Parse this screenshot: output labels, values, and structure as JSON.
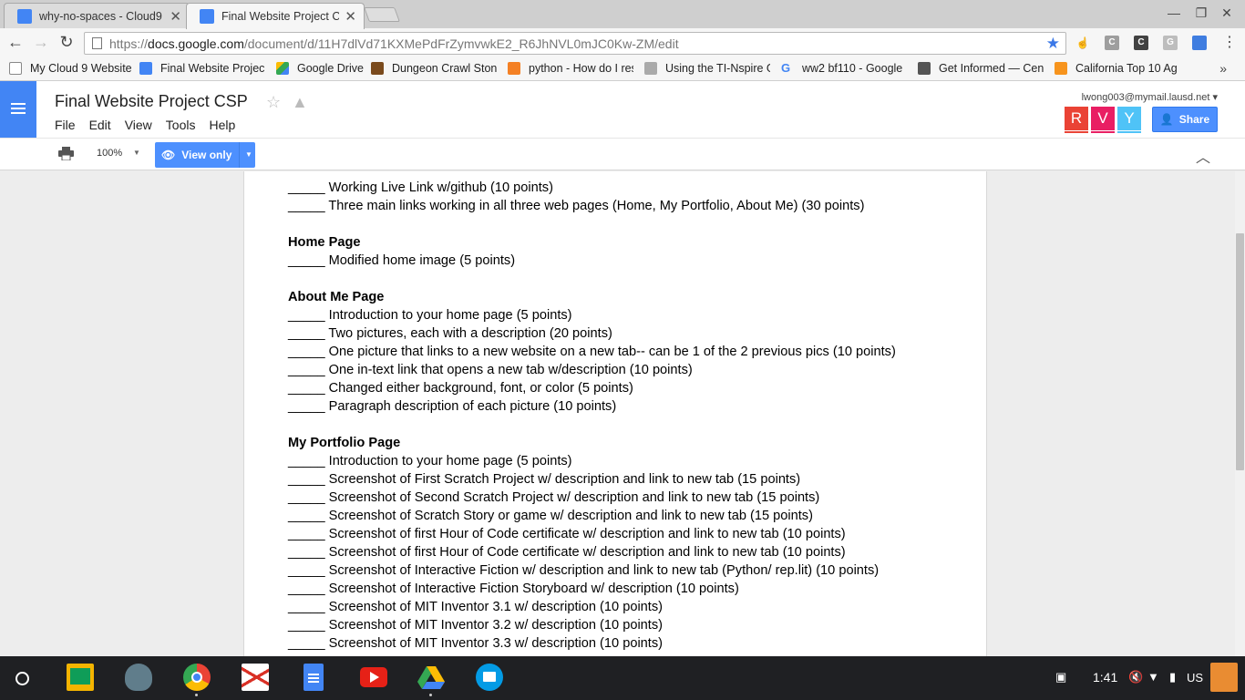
{
  "browser": {
    "tabs": [
      {
        "title": "why-no-spaces - Cloud9",
        "active": false,
        "favicon_color": "#4285f4"
      },
      {
        "title": "Final Website Project CS",
        "active": true,
        "favicon_color": "#4285f4"
      }
    ],
    "url": {
      "scheme": "https://",
      "host": "docs.google.com",
      "path": "/document/d/11H7dlVd71KXMePdFrZymvwkE2_R6JhNVL0mJC0Kw-ZM/edit"
    },
    "extensions": [
      "C",
      "C",
      "G"
    ],
    "bookmarks": [
      {
        "label": "My Cloud 9 Website",
        "icon": "page-icon",
        "color": "#888888"
      },
      {
        "label": "Final Website Project",
        "icon": "docs-icon",
        "color": "#4285f4"
      },
      {
        "label": "Google Drive",
        "icon": "drive-icon",
        "color": "#fbbc05"
      },
      {
        "label": "Dungeon Crawl Ston",
        "icon": "dungeon-icon",
        "color": "#7a4a1c"
      },
      {
        "label": "python - How do I res",
        "icon": "stackoverflow-icon",
        "color": "#f48024"
      },
      {
        "label": "Using the TI-Nspire G",
        "icon": "ti-icon",
        "color": "#aaaaaa"
      },
      {
        "label": "ww2 bf110 - Google",
        "icon": "google-icon",
        "color": "#4285f4"
      },
      {
        "label": "Get Informed — Cent",
        "icon": "informed-icon",
        "color": "#555555"
      },
      {
        "label": "California Top 10 Ag",
        "icon": "california-icon",
        "color": "#f7941d"
      }
    ],
    "bookmarks_more": "»"
  },
  "docs": {
    "title": "Final Website Project CSP",
    "menu": [
      "File",
      "Edit",
      "View",
      "Tools",
      "Help"
    ],
    "account": "lwong003@mymail.lausd.net",
    "collaborators": [
      {
        "initial": "R",
        "color": "#ea4335"
      },
      {
        "initial": "V",
        "color": "#e91e63"
      },
      {
        "initial": "Y",
        "color": "#4fc3f7"
      }
    ],
    "share_label": "Share",
    "zoom": "100%",
    "mode_label": "View only"
  },
  "document": {
    "lines": [
      {
        "type": "item",
        "text": "_____ Working Live Link w/github (10 points)"
      },
      {
        "type": "item",
        "text": "_____ Three main links working in all three web pages (Home, My Portfolio, About Me) (30 points)"
      },
      {
        "type": "blank",
        "text": ""
      },
      {
        "type": "heading",
        "text": "Home Page"
      },
      {
        "type": "item",
        "text": "_____ Modified home image (5 points)"
      },
      {
        "type": "blank",
        "text": ""
      },
      {
        "type": "heading",
        "text": "About Me Page"
      },
      {
        "type": "item",
        "text": "_____ Introduction to your home page (5 points)"
      },
      {
        "type": "item",
        "text": "_____ Two pictures, each with a description (20 points)"
      },
      {
        "type": "item",
        "text": "_____ One picture that links to a new website on a new tab-- can be 1 of the 2 previous pics (10 points)"
      },
      {
        "type": "item",
        "text": "_____ One in-text link that opens a new tab w/description (10 points)"
      },
      {
        "type": "item",
        "text": "_____ Changed either background, font, or color (5 points)"
      },
      {
        "type": "item",
        "text": "_____ Paragraph description of each picture (10 points)"
      },
      {
        "type": "blank",
        "text": ""
      },
      {
        "type": "heading",
        "text": "My Portfolio Page"
      },
      {
        "type": "item",
        "text": "_____ Introduction to your home page (5 points)"
      },
      {
        "type": "item",
        "text": "_____ Screenshot of First Scratch Project w/ description and link to new tab (15 points)"
      },
      {
        "type": "item",
        "text": "_____ Screenshot of Second Scratch Project w/ description and link to new tab (15 points)"
      },
      {
        "type": "item",
        "text": "_____ Screenshot of Scratch Story or game w/ description and link to new tab (15 points)"
      },
      {
        "type": "item",
        "text": "_____ Screenshot of first Hour of Code certificate w/ description and link to new tab  (10 points)"
      },
      {
        "type": "item",
        "text": "_____ Screenshot of first Hour of Code certificate w/ description and link to new tab  (10 points)"
      },
      {
        "type": "item",
        "text": "_____ Screenshot of Interactive Fiction w/ description and link to new tab (Python/ rep.lit) (10 points)"
      },
      {
        "type": "item",
        "text": "_____ Screenshot of Interactive Fiction Storyboard w/ description (10 points)"
      },
      {
        "type": "item",
        "text": "_____ Screenshot of MIT Inventor 3.1 w/ description (10 points)"
      },
      {
        "type": "item",
        "text": "_____ Screenshot of MIT Inventor 3.2 w/ description (10 points)"
      },
      {
        "type": "item",
        "text": "_____ Screenshot of MIT Inventor 3.3 w/ description (10 points)"
      }
    ]
  },
  "shelf": {
    "apps": [
      "classroom-icon",
      "shield-app-icon",
      "chrome-icon",
      "gmail-icon",
      "docs-app-icon",
      "youtube-icon",
      "drive-app-icon",
      "files-icon"
    ],
    "time": "1:41",
    "locale": "US"
  }
}
